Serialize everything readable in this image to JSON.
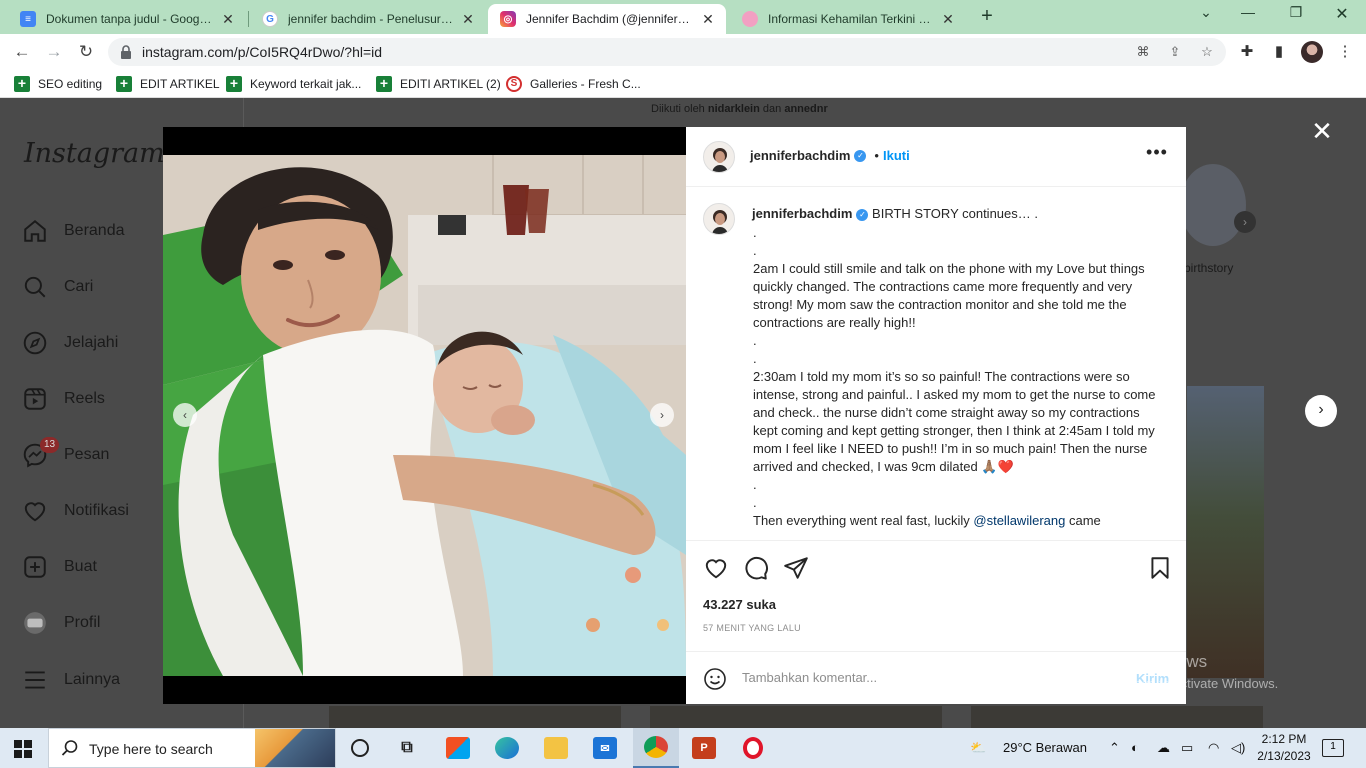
{
  "browser": {
    "tabs": [
      {
        "title": "Dokumen tanpa judul - Google D",
        "icon": "docs-icon",
        "active": false
      },
      {
        "title": "jennifer bachdim - Penelusuran G",
        "icon": "google-icon",
        "active": false
      },
      {
        "title": "Jennifer Bachdim (@jenniferbach",
        "icon": "instagram-icon",
        "active": true
      },
      {
        "title": "Informasi Kehamilan Terkini dan T",
        "icon": "site-icon",
        "active": false
      }
    ],
    "url": "instagram.com/p/CoI5RQ4rDwo/?hl=id",
    "bookmarks": [
      "SEO editing",
      "EDIT ARTIKEL",
      "Keyword terkait jak...",
      "EDITI ARTIKEL (2)",
      "Galleries - Fresh C..."
    ]
  },
  "sidebar": {
    "logo": "Instagram",
    "items": [
      {
        "label": "Beranda",
        "icon": "home-icon"
      },
      {
        "label": "Cari",
        "icon": "search-icon"
      },
      {
        "label": "Jelajahi",
        "icon": "compass-icon"
      },
      {
        "label": "Reels",
        "icon": "reels-icon"
      },
      {
        "label": "Pesan",
        "icon": "messenger-icon"
      },
      {
        "label": "Notifikasi",
        "icon": "heart-icon"
      },
      {
        "label": "Buat",
        "icon": "plus-square-icon"
      },
      {
        "label": "Profil",
        "icon": "profile-avatar"
      },
      {
        "label": "Lainnya",
        "icon": "menu-icon"
      }
    ],
    "message_badge": "13"
  },
  "background": {
    "followed_by_prefix": "Diikuti oleh",
    "followed_by_user1": "nidarklein",
    "followed_by_and": "dan",
    "followed_by_user2": "annednr",
    "story_label": "birthstory"
  },
  "post": {
    "username": "jenniferbachdim",
    "follow_label": "Ikuti",
    "separator": "•",
    "caption_lines": [
      "BIRTH STORY continues… .",
      ".",
      ".",
      "2am I could still smile and talk on the phone with my Love but things quickly changed. The contractions came more frequently and very strong! My mom saw the contraction monitor and she told me the contractions are really high!!",
      ".",
      ".",
      "2:30am I told my mom it’s so so painful! The contractions were so intense, strong and painful.. I asked my mom to get the nurse to come and check.. the nurse didn’t come straight away so my contractions kept coming and kept getting stronger, then I think at 2:45am I told my mom I feel like I NEED to push!! I’m in so much pain! Then the nurse arrived and checked, I was 9cm dilated 🙏🏽❤️",
      ".",
      ".",
      "Then everything went real fast, luckily "
    ],
    "caption_mention": "@stellawilerang",
    "caption_tail": " came",
    "likes": "43.227 suka",
    "time_ago": "57 MENIT YANG LALU",
    "comment_placeholder": "Tambahkan komentar...",
    "post_button": "Kirim"
  },
  "watermark": {
    "title": "Activate Windows",
    "subtitle": "Go to Settings to activate Windows."
  },
  "taskbar": {
    "search_placeholder": "Type here to search",
    "weather": "29°C  Berawan",
    "time": "2:12 PM",
    "date": "2/13/2023",
    "notification_count": "1"
  },
  "colors": {
    "tabbar": "#b6dfc2",
    "instagram_blue": "#0095f6",
    "dim_overlay": "#4a4a4a"
  }
}
